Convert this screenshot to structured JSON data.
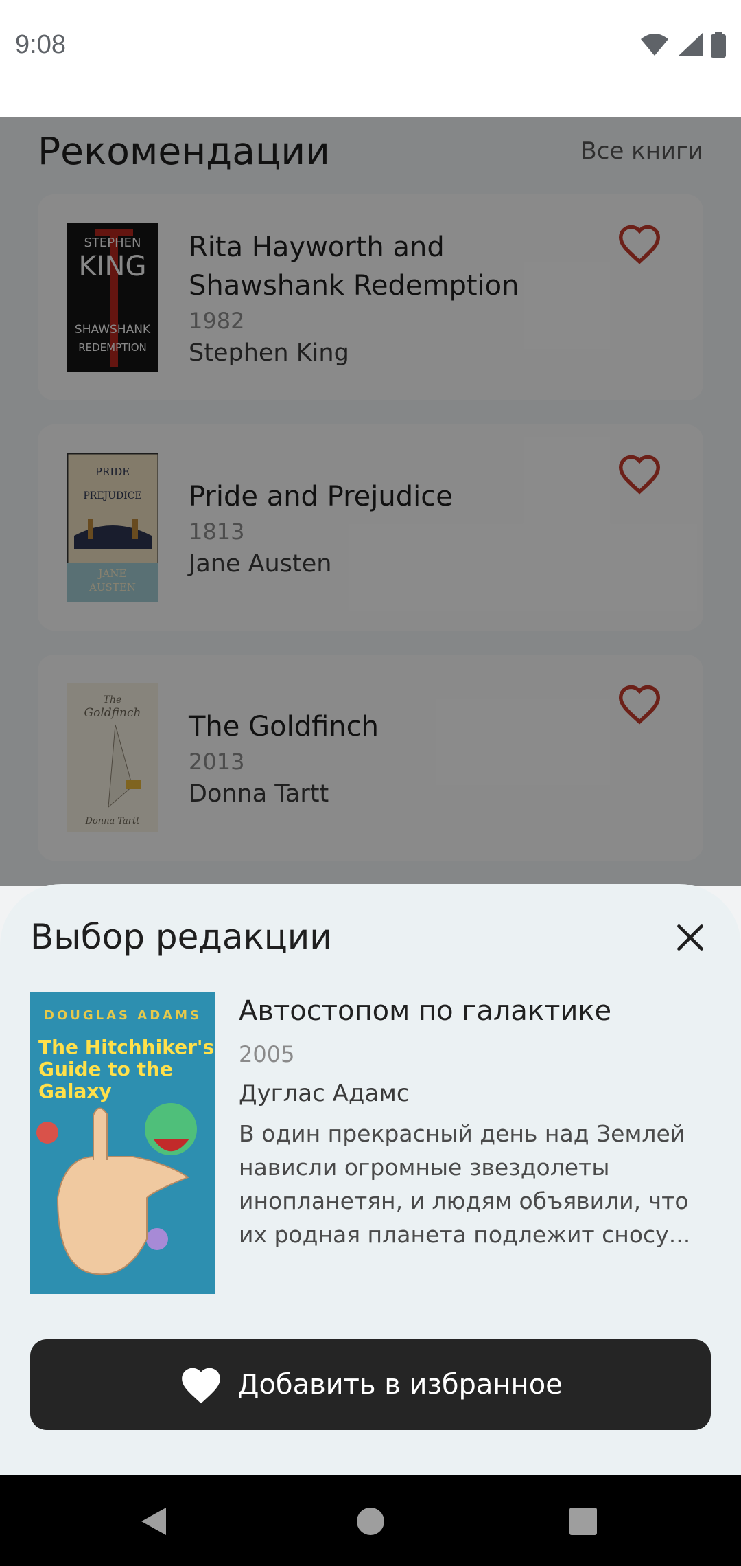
{
  "status_bar": {
    "time": "9:08"
  },
  "recommendations": {
    "title": "Рекомендации",
    "all_books_link": "Все книги",
    "books": [
      {
        "title": "Rita Hayworth and Shawshank Redemption",
        "year": "1982",
        "author": "Stephen King",
        "cover_text": [
          "STEPHEN",
          "KING",
          "SHAWSHANK",
          "REDEMPTION"
        ]
      },
      {
        "title": "Pride and Prejudice",
        "year": "1813",
        "author": "Jane Austen",
        "cover_text": [
          "PRIDE",
          "PREJUDICE",
          "JANE",
          "AUSTEN"
        ]
      },
      {
        "title": "The Goldfinch",
        "year": "2013",
        "author": "Donna Tartt",
        "cover_text": [
          "The",
          "Goldfinch",
          "Donna Tartt"
        ]
      }
    ]
  },
  "editors_choice": {
    "title": "Выбор редакции",
    "book": {
      "title": "Автостопом по галактике",
      "year": "2005",
      "author": "Дуглас Адамс",
      "description": "В один прекрасный день над Землей нависли огромные звездолеты инопланетян, и людям объявили, что их родная планета подлежит сносу...",
      "cover_text": [
        "DOUGLAS ADAMS",
        "The Hitchhiker's",
        "Guide to the",
        "Galaxy"
      ]
    },
    "add_button_label": "Добавить в избранное"
  },
  "colors": {
    "heart": "#c0392b",
    "button": "#252525",
    "sheet": "#ebf1f3"
  }
}
